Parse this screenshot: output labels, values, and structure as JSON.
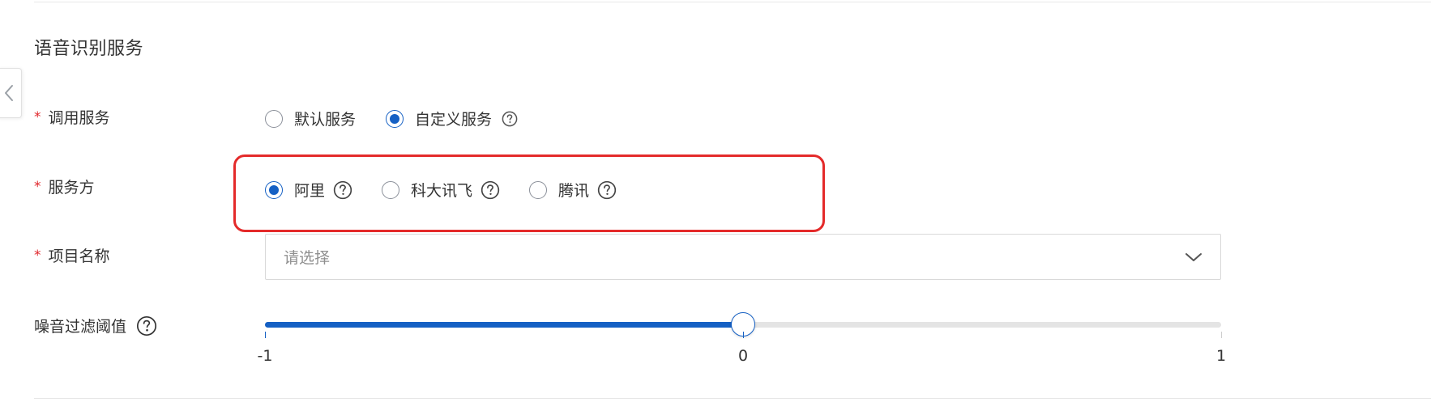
{
  "section": {
    "title": "语音识别服务"
  },
  "fields": {
    "invoke_service": {
      "label": "调用服务",
      "required": "*",
      "options": [
        {
          "label": "默认服务",
          "checked": false
        },
        {
          "label": "自定义服务",
          "checked": true
        }
      ]
    },
    "provider": {
      "label": "服务方",
      "required": "*",
      "options": [
        {
          "label": "阿里",
          "checked": true
        },
        {
          "label": "科大讯飞",
          "checked": false
        },
        {
          "label": "腾讯",
          "checked": false
        }
      ]
    },
    "project_name": {
      "label": "项目名称",
      "required": "*",
      "placeholder": "请选择"
    },
    "noise_threshold": {
      "label": "噪音过滤阈值",
      "min": -1,
      "max": 1,
      "value": 0,
      "marks": [
        "-1",
        "0",
        "1"
      ]
    }
  },
  "colors": {
    "accent": "#1560c4",
    "required": "#e0262b",
    "highlight": "#e42a2a"
  },
  "icons": {
    "collapse": "chevron-left-icon",
    "help": "question-circle-icon",
    "dropdown": "chevron-down-icon"
  }
}
